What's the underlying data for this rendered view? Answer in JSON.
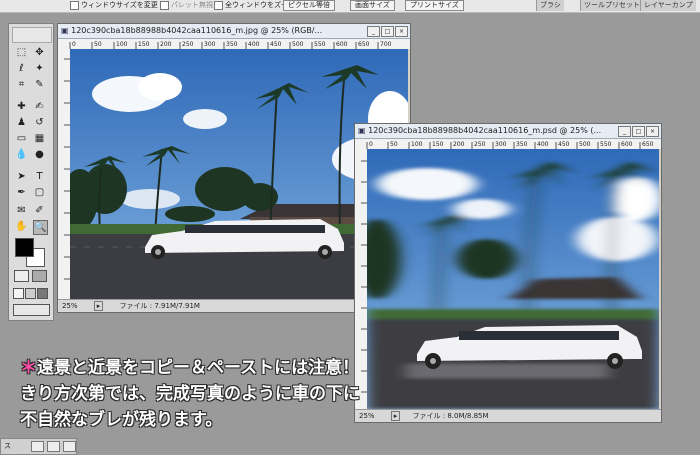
{
  "options_bar": {
    "fit_window": "ウィンドウサイズを変更",
    "ignore_palettes": "パレット無視",
    "zoom_all": "全ウィンドウをズーム",
    "actual_pixels": "ピクセル等倍",
    "fit_screen": "画面サイズ",
    "print_size": "プリントサイズ"
  },
  "dock_tabs": [
    "ブラシ",
    "ツールプリセット",
    "レイヤーカンプ"
  ],
  "window1": {
    "title": "120c390cba18b88988b4042caa110616_m.jpg @ 25% (RGB/...",
    "zoom": "25%",
    "file_info": "ファイル : 7.91M/7.91M",
    "ruler_marks": [
      "0",
      "50",
      "100",
      "150",
      "200",
      "250",
      "300",
      "350",
      "400",
      "450",
      "500",
      "550",
      "600",
      "650",
      "700"
    ]
  },
  "window2": {
    "title": "120c390cba18b88988b4042caa110616_m.psd @ 25% (...",
    "zoom": "25%",
    "file_info": "ファイル : 8.0M/8.85M",
    "ruler_marks": [
      "0",
      "50",
      "100",
      "150",
      "200",
      "250",
      "300",
      "350",
      "400",
      "450",
      "500",
      "550",
      "600",
      "650"
    ]
  },
  "note": {
    "line1_star": "＊",
    "line1": "遠景と近景をコピー＆ペーストには注意！",
    "line2": "きり方次第では、完成写真のように車の下に",
    "line3": "不自然なブレが残ります。"
  },
  "taskbar": {
    "label": "ス"
  },
  "colors": {
    "note_star": "#ff4fa8",
    "sky": "#4a7fc4",
    "road": "#3e3f44"
  }
}
